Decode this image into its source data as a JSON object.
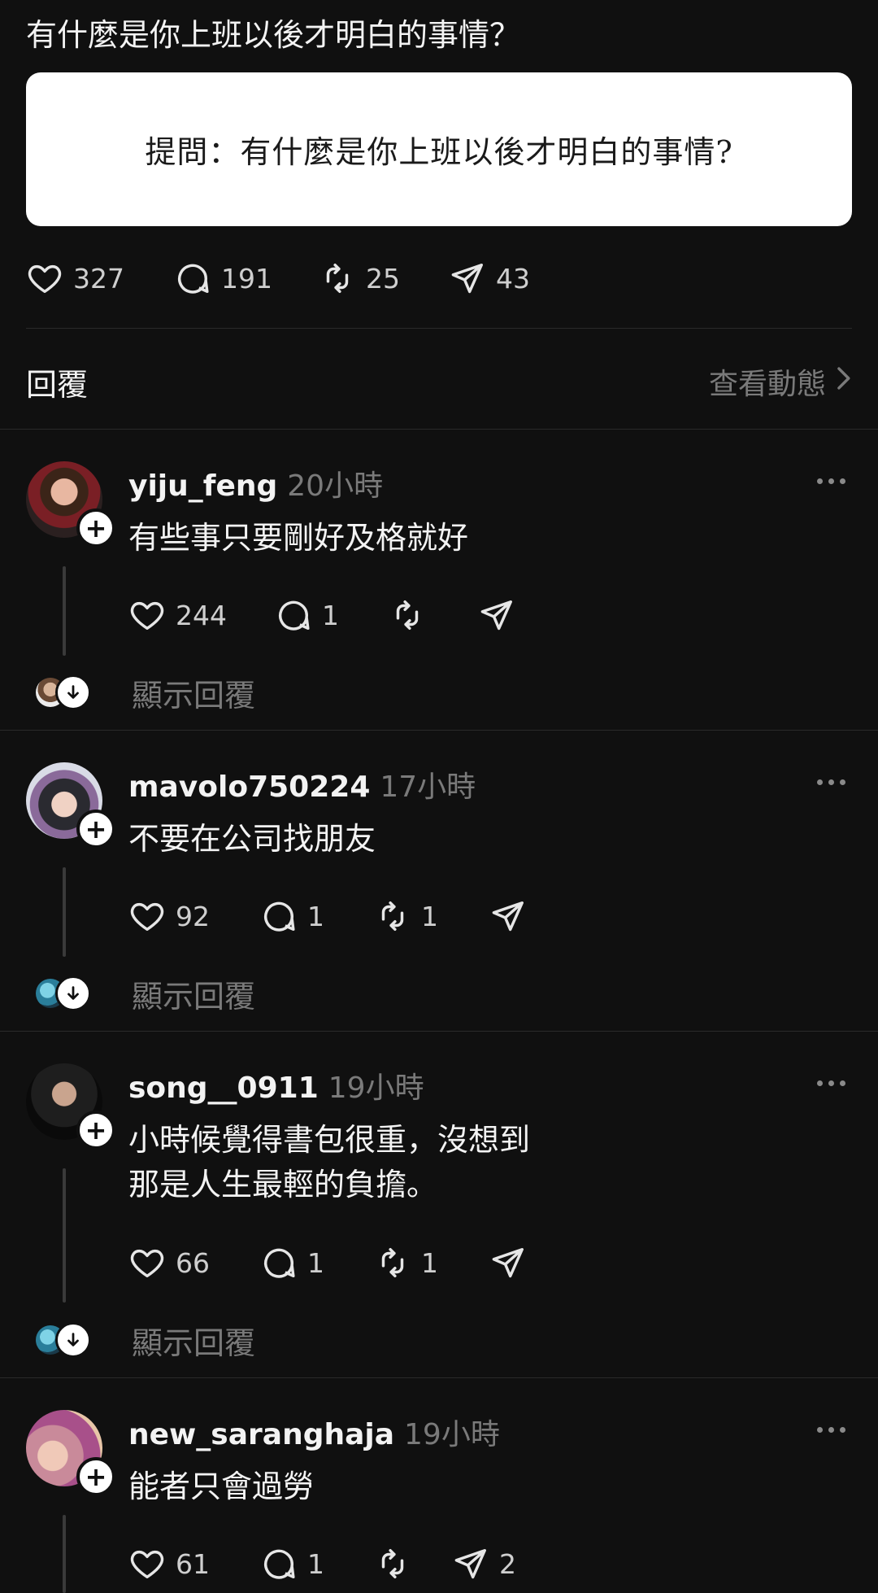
{
  "post": {
    "title": "有什麼是你上班以後才明白的事情？",
    "quote_image_text": "提問：有什麼是你上班以後才明白的事情?",
    "likes": "327",
    "comments": "191",
    "reposts": "25",
    "shares": "43"
  },
  "section": {
    "label": "回覆",
    "view_activity": "查看動態"
  },
  "replies": [
    {
      "username": "yiju_feng",
      "time": "20小時",
      "lines": [
        "有些事只要剛好及格就好"
      ],
      "likes": "244",
      "comments": "1",
      "reposts": "",
      "shares": "",
      "show_replies": "顯示回覆"
    },
    {
      "username": "mavolo750224",
      "time": "17小時",
      "lines": [
        "不要在公司找朋友"
      ],
      "likes": "92",
      "comments": "1",
      "reposts": "1",
      "shares": "",
      "show_replies": "顯示回覆"
    },
    {
      "username": "song__0911",
      "time": "19小時",
      "lines": [
        "小時候覺得書包很重，沒想到",
        "那是人生最輕的負擔。"
      ],
      "likes": "66",
      "comments": "1",
      "reposts": "1",
      "shares": "",
      "show_replies": "顯示回覆"
    },
    {
      "username": "new_saranghaja",
      "time": "19小時",
      "lines": [
        "能者只會過勞"
      ],
      "likes": "61",
      "comments": "1",
      "reposts": "",
      "shares": "2",
      "show_replies": ""
    }
  ],
  "colors": {
    "background": "#101010",
    "text": "#f3f3f3",
    "muted": "#7a7a7a",
    "card": "#ffffff"
  },
  "icons": [
    "heart-icon",
    "comment-icon",
    "repost-icon",
    "share-icon",
    "chevron-right-icon",
    "more-icon",
    "follow-plus-icon",
    "arrow-down-icon"
  ]
}
